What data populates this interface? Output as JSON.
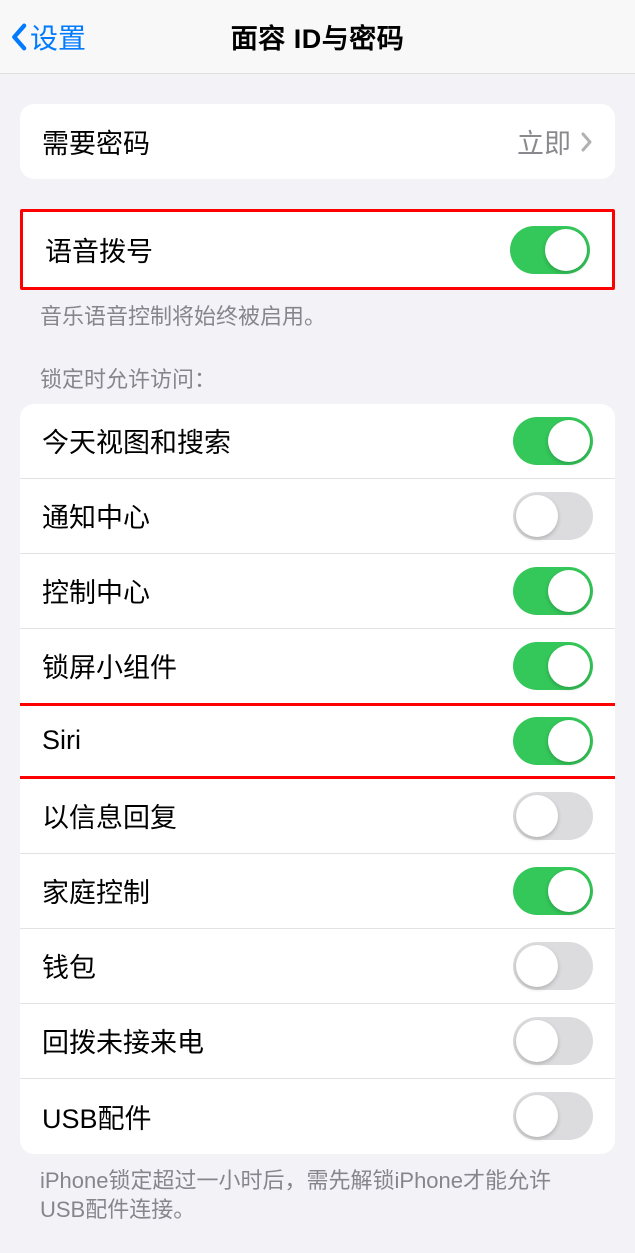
{
  "nav": {
    "back": "设置",
    "title": "面容 ID与密码"
  },
  "require_passcode": {
    "label": "需要密码",
    "value": "立即"
  },
  "voice_dial": {
    "label": "语音拨号",
    "on": true,
    "footer": "音乐语音控制将始终被启用。"
  },
  "lock_access": {
    "header": "锁定时允许访问：",
    "items": [
      {
        "label": "今天视图和搜索",
        "on": true,
        "highlighted": false
      },
      {
        "label": "通知中心",
        "on": false,
        "highlighted": false
      },
      {
        "label": "控制中心",
        "on": true,
        "highlighted": false
      },
      {
        "label": "锁屏小组件",
        "on": true,
        "highlighted": false
      },
      {
        "label": "Siri",
        "on": true,
        "highlighted": true
      },
      {
        "label": "以信息回复",
        "on": false,
        "highlighted": false
      },
      {
        "label": "家庭控制",
        "on": true,
        "highlighted": false
      },
      {
        "label": "钱包",
        "on": false,
        "highlighted": false
      },
      {
        "label": "回拨未接来电",
        "on": false,
        "highlighted": false
      },
      {
        "label": "USB配件",
        "on": false,
        "highlighted": false
      }
    ],
    "footer": "iPhone锁定超过一小时后，需先解锁iPhone才能允许USB配件连接。"
  }
}
